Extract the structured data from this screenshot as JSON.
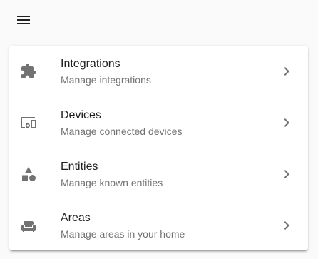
{
  "header": {
    "menu_icon": "hamburger-menu-icon"
  },
  "colors": {
    "background": "#fafafa",
    "card": "#ffffff",
    "title_text": "#212121",
    "subtitle_text": "#727272",
    "icon": "#727272",
    "menu_icon": "#212121"
  },
  "items": [
    {
      "icon": "puzzle-icon",
      "title": "Integrations",
      "subtitle": "Manage integrations"
    },
    {
      "icon": "devices-icon",
      "title": "Devices",
      "subtitle": "Manage connected devices"
    },
    {
      "icon": "shapes-icon",
      "title": "Entities",
      "subtitle": "Manage known entities"
    },
    {
      "icon": "sofa-icon",
      "title": "Areas",
      "subtitle": "Manage areas in your home"
    }
  ]
}
